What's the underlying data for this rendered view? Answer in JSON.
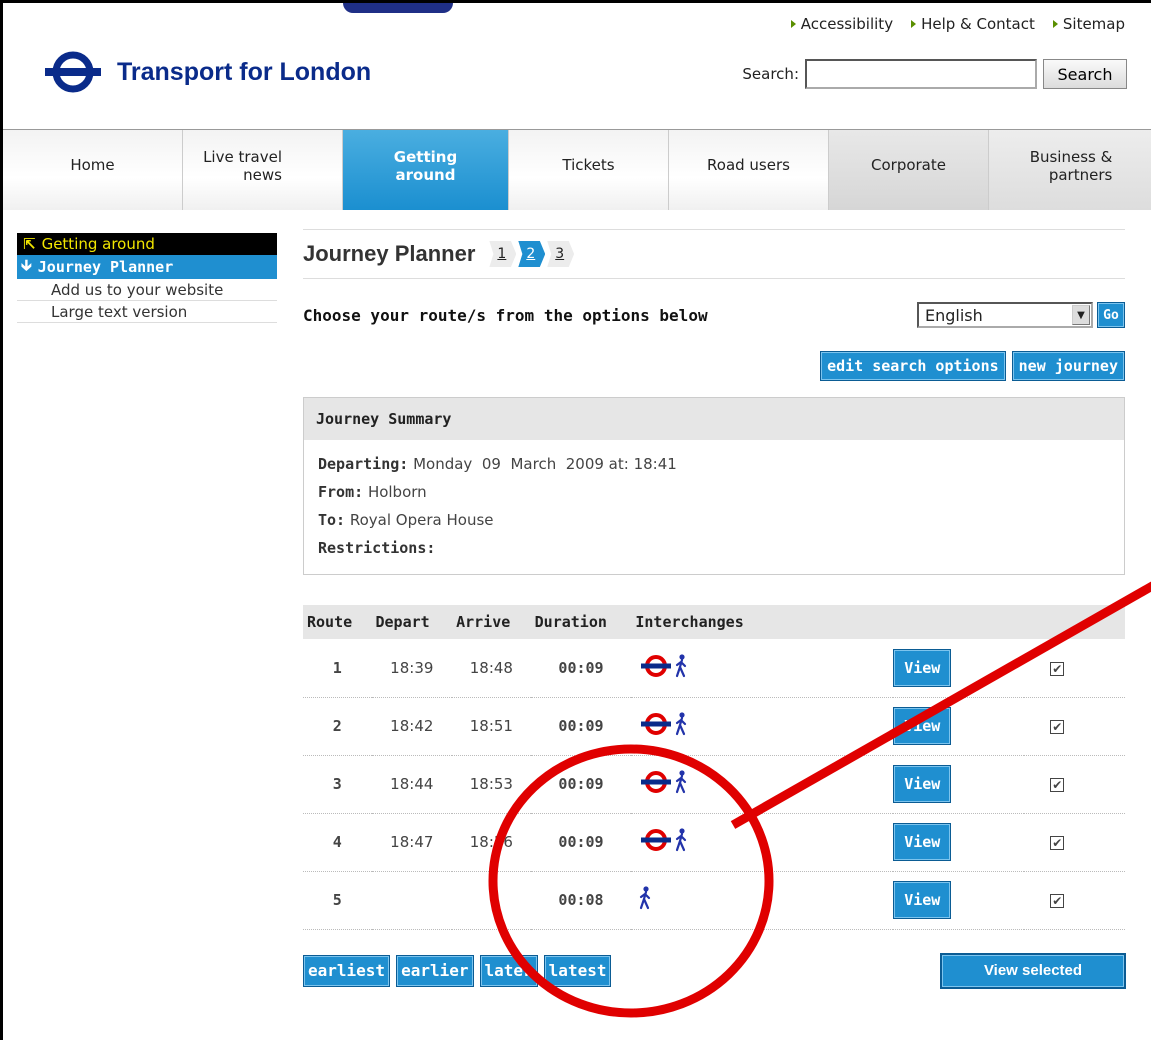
{
  "header": {
    "util_links": [
      "Accessibility",
      "Help & Contact",
      "Sitemap"
    ],
    "logo_title": "Transport for London",
    "search_label": "Search:",
    "search_value": "",
    "search_button": "Search"
  },
  "nav": {
    "home": "Home",
    "live": [
      "Live travel",
      "news"
    ],
    "getting": [
      "Getting",
      "around"
    ],
    "tickets": "Tickets",
    "road": "Road users",
    "corporate": "Corporate",
    "business": [
      "Business &",
      "partners"
    ]
  },
  "sidebar": {
    "getting_around": "Getting around",
    "journey_planner": "Journey Planner",
    "items": [
      "Add us to your website",
      "Large text version"
    ]
  },
  "main": {
    "title": "Journey Planner",
    "steps": [
      "1",
      "2",
      "3"
    ],
    "choose": "Choose your route/s from the options below",
    "language": "English",
    "go": "Go",
    "edit_search": "edit search options",
    "new_journey": "new journey"
  },
  "summary": {
    "heading": "Journey Summary",
    "departing_label": "Departing:",
    "departing_value": "Monday  09  March  2009 at: 18:41",
    "from_label": "From:",
    "from_value": "Holborn",
    "to_label": "To:",
    "to_value": "Royal Opera House",
    "restrictions_label": "Restrictions:"
  },
  "routes": {
    "headers": [
      "Route",
      "Depart",
      "Arrive",
      "Duration",
      "Interchanges"
    ],
    "rows": [
      {
        "route": "1",
        "depart": "18:39",
        "arrive": "18:48",
        "duration": "00:09",
        "icons": [
          "underground-icon",
          "walk-icon"
        ],
        "view": "View",
        "checked": true
      },
      {
        "route": "2",
        "depart": "18:42",
        "arrive": "18:51",
        "duration": "00:09",
        "icons": [
          "underground-icon",
          "walk-icon"
        ],
        "view": "View",
        "checked": true
      },
      {
        "route": "3",
        "depart": "18:44",
        "arrive": "18:53",
        "duration": "00:09",
        "icons": [
          "underground-icon",
          "walk-icon"
        ],
        "view": "View",
        "checked": true
      },
      {
        "route": "4",
        "depart": "18:47",
        "arrive": "18:56",
        "duration": "00:09",
        "icons": [
          "underground-icon",
          "walk-icon"
        ],
        "view": "View",
        "checked": true
      },
      {
        "route": "5",
        "depart": "",
        "arrive": "",
        "duration": "00:08",
        "icons": [
          "walk-icon"
        ],
        "view": "View",
        "checked": true
      }
    ]
  },
  "pager": {
    "earliest": "earliest",
    "earlier": "earlier",
    "later": "later",
    "latest": "latest",
    "view_selected": "View selected"
  },
  "colors": {
    "accent": "#1f8fd0",
    "brand": "#0a2b8a",
    "annotation": "#e00000"
  }
}
